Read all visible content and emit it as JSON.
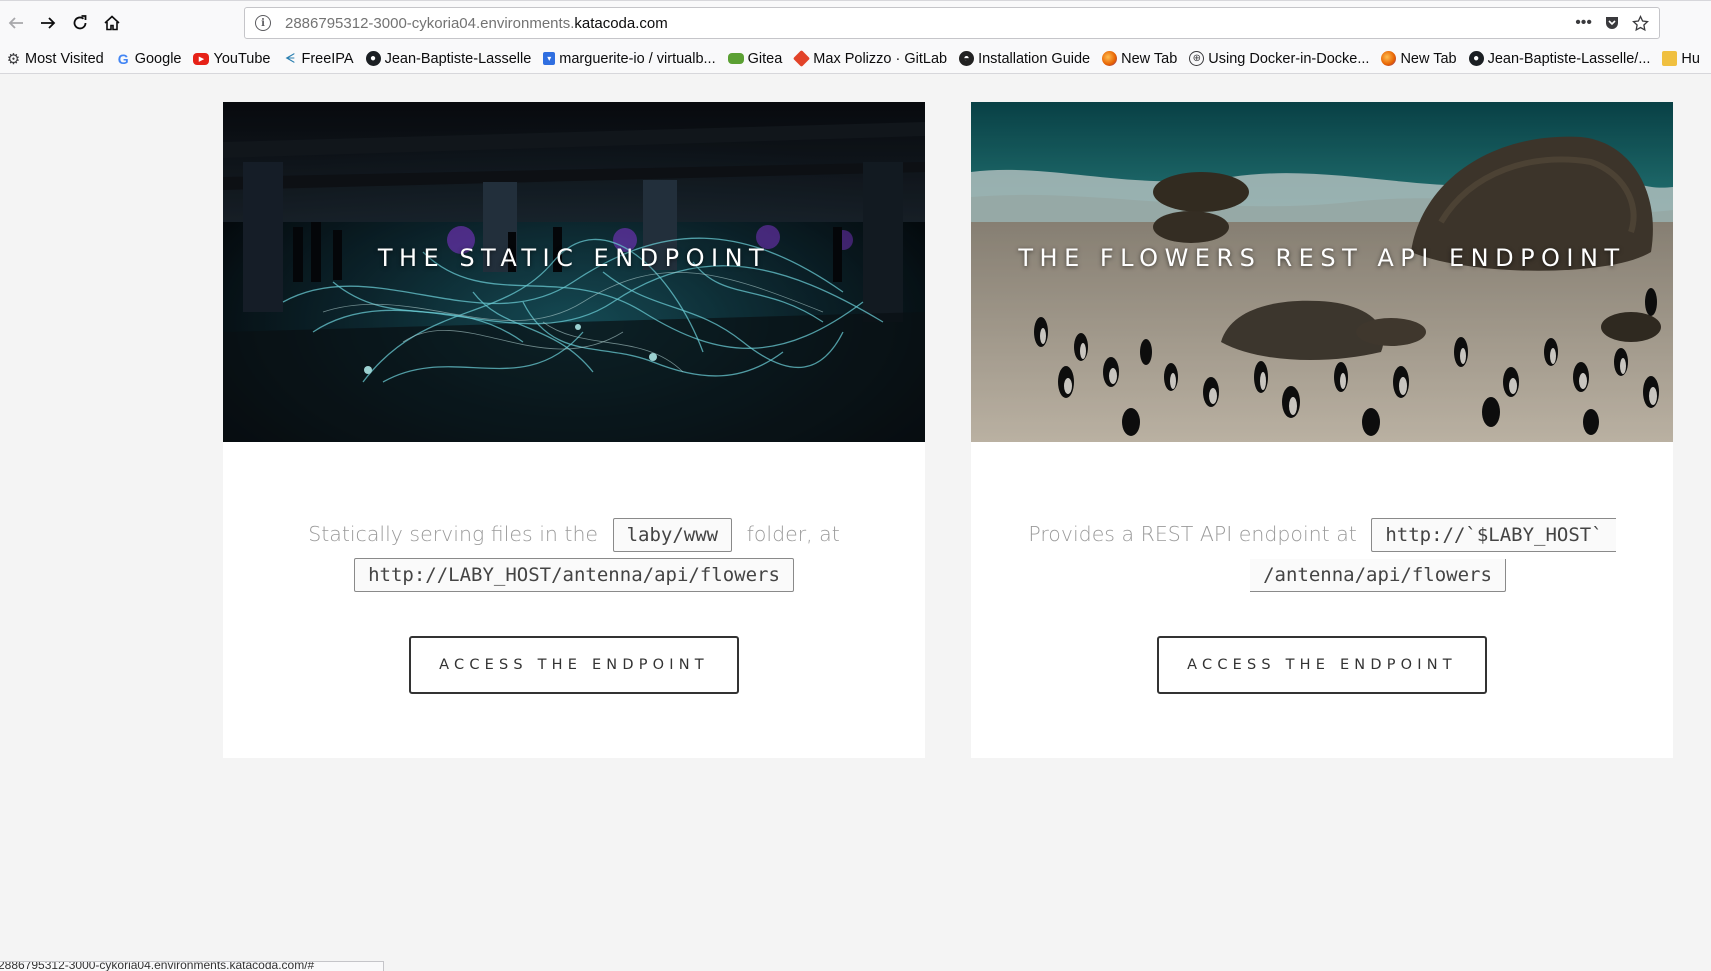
{
  "browser": {
    "url_prefix": "2886795312-3000-cykoria04.environments.",
    "url_domain": "katacoda.com",
    "status_text": "2886795312-3000-cykoria04.environments.katacoda.com/#"
  },
  "bookmarks": [
    {
      "label": "Most Visited",
      "icon": "gear-icon"
    },
    {
      "label": "Google",
      "icon": "google-icon"
    },
    {
      "label": "YouTube",
      "icon": "youtube-icon"
    },
    {
      "label": "FreeIPA",
      "icon": "freeipa-icon"
    },
    {
      "label": "Jean-Baptiste-Lasselle",
      "icon": "github-icon"
    },
    {
      "label": "marguerite-io / virtualb...",
      "icon": "bookmark-icon"
    },
    {
      "label": "Gitea",
      "icon": "gitea-icon"
    },
    {
      "label": "Max Polizzo · GitLab",
      "icon": "gitlab-icon"
    },
    {
      "label": "Installation Guide",
      "icon": "install-icon"
    },
    {
      "label": "New Tab",
      "icon": "firefox-icon"
    },
    {
      "label": "Using Docker-in-Docke...",
      "icon": "globe-icon"
    },
    {
      "label": "New Tab",
      "icon": "firefox-icon"
    },
    {
      "label": "Jean-Baptiste-Lasselle/...",
      "icon": "github-icon"
    },
    {
      "label": "Hu",
      "icon": "hub-icon"
    }
  ],
  "cards": [
    {
      "title": "THE STATIC ENDPOINT",
      "desc_part1": "Statically serving files in the",
      "code1": "laby/www",
      "desc_part2": "folder, at",
      "code2": "http://LABY_HOST/antenna/api/flowers",
      "button": "ACCESS THE ENDPOINT"
    },
    {
      "title": "THE FLOWERS REST API ENDPOINT",
      "desc_part1": "Provides a REST API endpoint at",
      "code1": "http://`$LABY_HOST`",
      "code2": "/antenna/api/flowers",
      "button": "ACCESS THE ENDPOINT"
    }
  ]
}
